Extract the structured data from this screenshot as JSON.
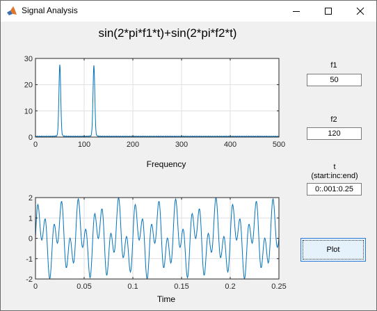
{
  "window": {
    "title": "Signal Analysis"
  },
  "plot": {
    "title": "sin(2*pi*f1*t)+sin(2*pi*f2*t)"
  },
  "controls": {
    "f1": {
      "label": "f1",
      "value": "50"
    },
    "f2": {
      "label": "f2",
      "value": "120"
    },
    "t": {
      "label": "t",
      "sublabel": "(start:inc:end)",
      "value": "0:.001:0.25"
    },
    "plot_button": "Plot"
  },
  "chart_data": [
    {
      "type": "line",
      "name": "frequency-spectrum",
      "xlabel": "Frequency",
      "ylabel": "",
      "xlim": [
        0,
        500
      ],
      "ylim": [
        0,
        30
      ],
      "xticks": [
        "0",
        "100",
        "200",
        "300",
        "400",
        "500"
      ],
      "yticks": [
        "0",
        "10",
        "20",
        "30"
      ],
      "grid": true,
      "color": "#0072bd",
      "peaks": [
        {
          "x": 50,
          "y": 26.5
        },
        {
          "x": 120,
          "y": 26.2
        }
      ]
    },
    {
      "type": "line",
      "name": "time-signal",
      "xlabel": "Time",
      "ylabel": "",
      "xlim": [
        0,
        0.25
      ],
      "ylim": [
        -2,
        2
      ],
      "xticks": [
        "0",
        "0.05",
        "0.1",
        "0.15",
        "0.2",
        "0.25"
      ],
      "yticks": [
        "-2",
        "-1",
        "0",
        "1",
        "2"
      ],
      "grid": true,
      "color": "#0072bd",
      "f1": 50,
      "f2": 120
    }
  ]
}
